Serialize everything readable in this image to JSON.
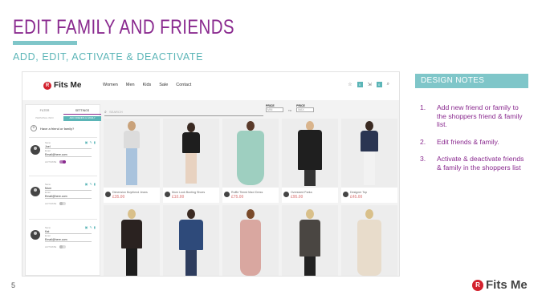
{
  "slide": {
    "title": "EDIT FAMILY AND FRIENDS",
    "subtitle": "ADD, EDIT, ACTIVATE & DEACTIVATE",
    "page_number": "5",
    "footer_brand": "Fits Me",
    "footer_mark": "R"
  },
  "app": {
    "brand": "Fits Me",
    "brand_mark": "R",
    "nav": [
      "Women",
      "Men",
      "Kids",
      "Sale",
      "Contact"
    ],
    "nav_badge": "0",
    "search_placeholder": "SEARCH",
    "price_min_label": "PRICE",
    "price_min_value": "MIN",
    "price_to": "TO",
    "price_max_label": "PRICE",
    "price_max_value": "MAX"
  },
  "sidepanel": {
    "tabs": [
      "FILTER",
      "SETTINGS"
    ],
    "subtabs": [
      "PERSONAL INFO",
      "ADD FRIENDS & FAMILY"
    ],
    "add_label": "Have a friend or family?",
    "add_symbol": "+",
    "friends": [
      {
        "name_label": "Name",
        "name": "Joel",
        "email_label": "Email",
        "email": "Email@here.com",
        "activate_label": "ACTIVATE",
        "active": true
      },
      {
        "name_label": "Name",
        "name": "Mum",
        "email_label": "Email",
        "email": "Email@here.com",
        "activate_label": "ACTIVATE",
        "active": false
      },
      {
        "name_label": "Name",
        "name": "Kat",
        "email_label": "Email",
        "email": "Email@here.com",
        "activate_label": "ACTIVATE",
        "active": false
      }
    ]
  },
  "products": [
    {
      "name": "Dimension Boyfriend Jeans",
      "price": "£35.00"
    },
    {
      "name": "Mum Look Bunting Shoes",
      "price": "£10.00"
    },
    {
      "name": "Ruffle Tiered Maxi Dress",
      "price": "£75.00"
    },
    {
      "name": "Oversized Parka",
      "price": "£95.00"
    },
    {
      "name": "Designer Top",
      "price": "£45.00"
    },
    {
      "name": "",
      "price": ""
    },
    {
      "name": "",
      "price": ""
    },
    {
      "name": "",
      "price": ""
    },
    {
      "name": "",
      "price": ""
    },
    {
      "name": "",
      "price": ""
    }
  ],
  "design_notes": {
    "header": "DESIGN NOTES",
    "items": [
      {
        "num": "1.",
        "text": "Add new friend or family to the shoppers friend & family list."
      },
      {
        "num": "2.",
        "text": "Edit friends & family."
      },
      {
        "num": "3.",
        "text": "Activate & deactivate friends & family in the shoppers list"
      }
    ]
  },
  "colors": {
    "title_purple": "#8a2a8f",
    "accent_teal": "#7fc6c9",
    "brand_red": "#d3212d",
    "price_pink": "#e39a9a"
  }
}
